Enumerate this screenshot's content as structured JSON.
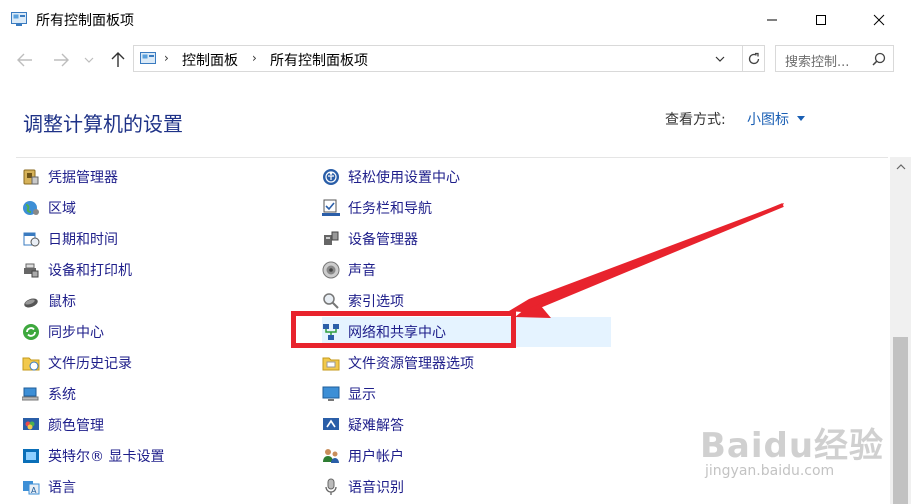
{
  "window": {
    "title": "所有控制面板项",
    "controls": [
      "minimize",
      "maximize",
      "close"
    ]
  },
  "nav": {
    "back_icon": "back-arrow-icon",
    "forward_icon": "forward-arrow-icon",
    "history_icon": "chevron-down-icon",
    "up_icon": "up-arrow-icon"
  },
  "address": {
    "crumbs": [
      "控制面板",
      "所有控制面板项"
    ],
    "refresh_icon": "refresh-icon"
  },
  "search": {
    "placeholder": "搜索控制..."
  },
  "main": {
    "heading": "调整计算机的设置",
    "view_by_label": "查看方式:",
    "view_by_value": "小图标"
  },
  "items_left": [
    {
      "label": "凭据管理器",
      "icon": "credential-manager-icon"
    },
    {
      "label": "区域",
      "icon": "region-globe-icon"
    },
    {
      "label": "日期和时间",
      "icon": "calendar-clock-icon"
    },
    {
      "label": "设备和打印机",
      "icon": "printer-icon"
    },
    {
      "label": "鼠标",
      "icon": "mouse-icon"
    },
    {
      "label": "同步中心",
      "icon": "sync-icon"
    },
    {
      "label": "文件历史记录",
      "icon": "file-history-icon"
    },
    {
      "label": "系统",
      "icon": "computer-icon"
    },
    {
      "label": "颜色管理",
      "icon": "color-management-icon"
    },
    {
      "label": "英特尔® 显卡设置",
      "icon": "intel-graphics-icon"
    },
    {
      "label": "语言",
      "icon": "language-icon"
    }
  ],
  "items_right": [
    {
      "label": "轻松使用设置中心",
      "icon": "ease-of-access-icon"
    },
    {
      "label": "任务栏和导航",
      "icon": "taskbar-icon"
    },
    {
      "label": "设备管理器",
      "icon": "device-manager-icon"
    },
    {
      "label": "声音",
      "icon": "speaker-icon"
    },
    {
      "label": "索引选项",
      "icon": "indexing-icon"
    },
    {
      "label": "网络和共享中心",
      "icon": "network-icon",
      "highlighted": true
    },
    {
      "label": "文件资源管理器选项",
      "icon": "folder-options-icon"
    },
    {
      "label": "显示",
      "icon": "display-icon"
    },
    {
      "label": "疑难解答",
      "icon": "troubleshooting-icon"
    },
    {
      "label": "用户帐户",
      "icon": "user-accounts-icon"
    },
    {
      "label": "语音识别",
      "icon": "microphone-icon"
    }
  ],
  "watermark": {
    "brand": "Baidu经验",
    "url": "jingyan.baidu.com"
  },
  "colors": {
    "annotation": "#e8232d",
    "link": "#1e1e8a",
    "heading": "#1e3287",
    "highlight": "#e5f3ff"
  }
}
